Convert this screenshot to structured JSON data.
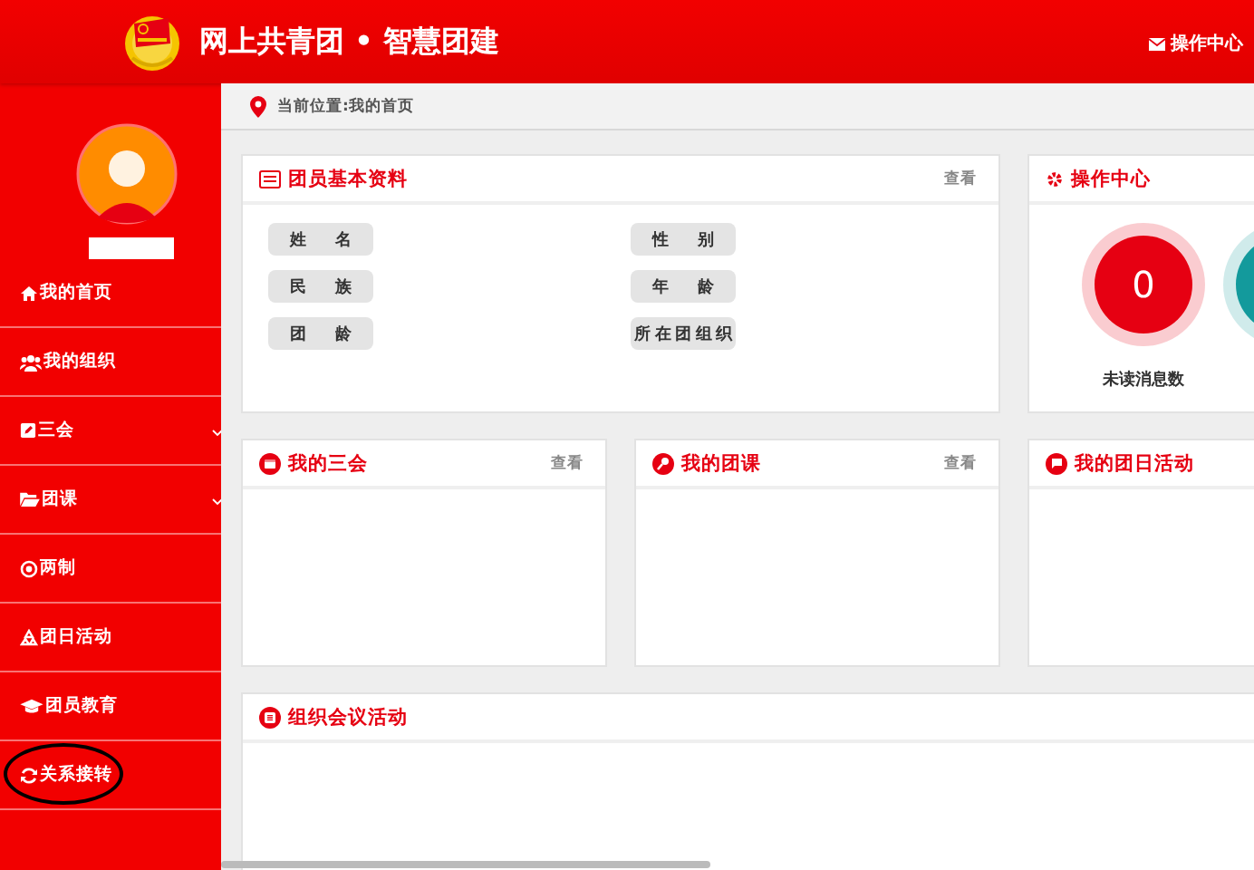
{
  "header": {
    "title": "网上共青团 • 智慧团建",
    "action": "操作中心"
  },
  "sidebar": {
    "items": [
      {
        "label": "我的首页",
        "expandable": false,
        "circled": false
      },
      {
        "label": "我的组织",
        "expandable": false,
        "circled": false
      },
      {
        "label": "三会",
        "expandable": true,
        "circled": false
      },
      {
        "label": "团课",
        "expandable": true,
        "circled": false
      },
      {
        "label": "两制",
        "expandable": false,
        "circled": false
      },
      {
        "label": "团日活动",
        "expandable": false,
        "circled": false
      },
      {
        "label": "团员教育",
        "expandable": false,
        "circled": false
      },
      {
        "label": "关系接转",
        "expandable": false,
        "circled": true
      }
    ]
  },
  "breadcrumb": "当前位置:我的首页",
  "profile_card": {
    "title": "团员基本资料",
    "link": "查看",
    "fields": [
      {
        "label": "姓名"
      },
      {
        "label": "性别"
      },
      {
        "label": "民族"
      },
      {
        "label": "年龄"
      },
      {
        "label": "团龄"
      },
      {
        "label": "所在团组织"
      }
    ]
  },
  "operation_card": {
    "title": "操作中心",
    "stats": [
      {
        "value": "0",
        "label": "未读消息数",
        "color": "#e60012"
      },
      {
        "color": "#139a9c"
      }
    ]
  },
  "cards": [
    {
      "title": "我的三会",
      "link": "查看"
    },
    {
      "title": "我的团课",
      "link": "查看"
    },
    {
      "title": "我的团日活动"
    }
  ],
  "meeting_card": {
    "title": "组织会议活动"
  }
}
